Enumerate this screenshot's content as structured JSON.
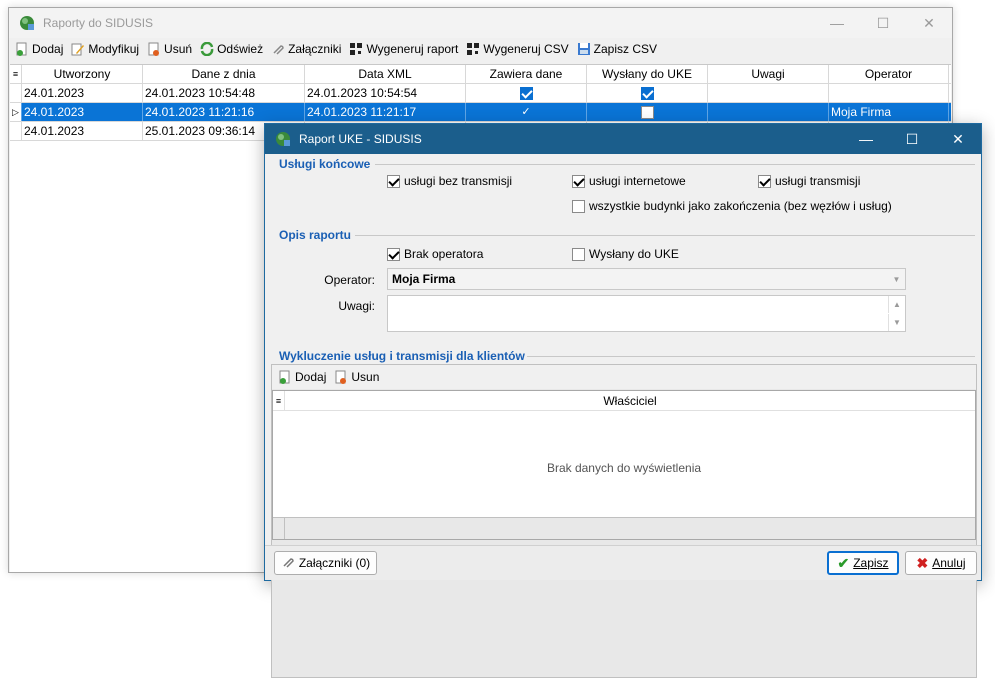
{
  "main_window": {
    "title": "Raporty do SIDUSIS",
    "toolbar": [
      {
        "label": "Dodaj",
        "icon": "add-doc-icon"
      },
      {
        "label": "Modyfikuj",
        "icon": "edit-icon"
      },
      {
        "label": "Usuń",
        "icon": "delete-doc-icon"
      },
      {
        "label": "Odśwież",
        "icon": "refresh-icon"
      },
      {
        "label": "Załączniki",
        "icon": "paperclip-icon"
      },
      {
        "label": "Wygeneruj raport",
        "icon": "qr-icon"
      },
      {
        "label": "Wygeneruj CSV",
        "icon": "qr-icon"
      },
      {
        "label": "Zapisz CSV",
        "icon": "save-icon"
      }
    ],
    "columns": [
      "Utworzony",
      "Dane z dnia",
      "Data XML",
      "Zawiera dane",
      "Wysłany do UKE",
      "Uwagi",
      "Operator"
    ],
    "rows": [
      {
        "created": "24.01.2023",
        "data_date": "24.01.2023 10:54:48",
        "xml_date": "24.01.2023 10:54:54",
        "contains_data": true,
        "sent": true,
        "notes": "",
        "operator": ""
      },
      {
        "created": "24.01.2023",
        "data_date": "24.01.2023 11:21:16",
        "xml_date": "24.01.2023 11:21:17",
        "contains_data": true,
        "sent": false,
        "notes": "",
        "operator": "Moja Firma"
      },
      {
        "created": "24.01.2023",
        "data_date": "25.01.2023 09:36:14",
        "xml_date": "",
        "contains_data": false,
        "sent": false,
        "notes": "",
        "operator": ""
      }
    ]
  },
  "dialog": {
    "title": "Raport UKE - SIDUSIS",
    "section_services": "Usługi końcowe",
    "cb_no_transmission": "usługi bez transmisji",
    "cb_internet": "usługi internetowe",
    "cb_transmission": "usługi transmisji",
    "cb_all_buildings": "wszystkie budynki jako zakończenia (bez węzłów i usług)",
    "section_desc": "Opis raportu",
    "cb_no_operator": "Brak operatora",
    "cb_sent_uke": "Wysłany do UKE",
    "operator_label": "Operator:",
    "operator_value": "Moja Firma",
    "notes_label": "Uwagi:",
    "section_exclusions": "Wykluczenie usług i transmisji dla klientów",
    "sub_add": "Dodaj",
    "sub_remove": "Usun",
    "owner_header": "Właściciel",
    "empty_text": "Brak danych do wyświetlenia",
    "attachments_btn": "Załączniki (0)",
    "save_btn": "Zapisz",
    "cancel_btn": "Anuluj"
  }
}
